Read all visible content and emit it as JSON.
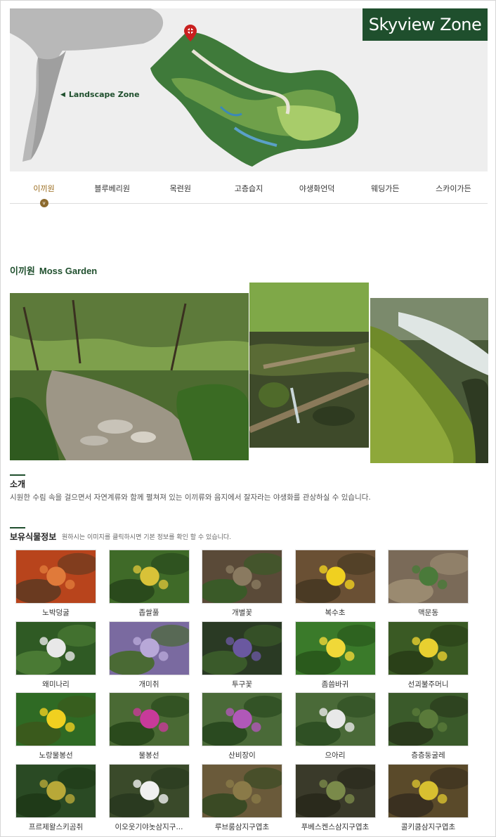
{
  "map": {
    "zone_badge": "Skyview Zone",
    "landscape_label": "Landscape Zone",
    "arrow_icon": "left-triangle-icon",
    "pin_icon": "map-pin-icon"
  },
  "tabs": [
    {
      "label": "이끼원",
      "active": true
    },
    {
      "label": "블루베리원",
      "active": false
    },
    {
      "label": "목련원",
      "active": false
    },
    {
      "label": "고층습지",
      "active": false
    },
    {
      "label": "야생화언덕",
      "active": false
    },
    {
      "label": "웨딩가든",
      "active": false
    },
    {
      "label": "스카이가든",
      "active": false
    }
  ],
  "section": {
    "title_ko": "이끼원",
    "title_en": "Moss Garden"
  },
  "intro": {
    "heading": "소개",
    "text": "시원한 수림 속을 걸으면서 자연계류와 함께 펼쳐져 있는 이끼류와 음지에서 잘자라는 야생화를 관상하실 수 있습니다."
  },
  "plants": {
    "heading": "보유식물정보",
    "note": "원하시는 이미지를 클릭하시면 기본 정보를 확인 할 수 있습니다.",
    "items": [
      {
        "name": "노박덩굴"
      },
      {
        "name": "좁쌀풀"
      },
      {
        "name": "개별꽃"
      },
      {
        "name": "복수초"
      },
      {
        "name": "맥문동"
      },
      {
        "name": "왜미나리"
      },
      {
        "name": "개미취"
      },
      {
        "name": "투구꽃"
      },
      {
        "name": "좀씀바귀"
      },
      {
        "name": "선괴불주머니"
      },
      {
        "name": "노랑물봉선"
      },
      {
        "name": "물봉선"
      },
      {
        "name": "산비장이"
      },
      {
        "name": "으아리"
      },
      {
        "name": "층층둥굴레"
      },
      {
        "name": "프르제왈스키곰취"
      },
      {
        "name": "이오웃기야놋삼지구..."
      },
      {
        "name": "루브룸삼지구엽초"
      },
      {
        "name": "푸베스켄스삼지구엽초"
      },
      {
        "name": "콜키쿰삼지구엽초"
      }
    ]
  },
  "colors": {
    "brand_green": "#1f4f2d",
    "active_tab": "#9a6b1c"
  }
}
